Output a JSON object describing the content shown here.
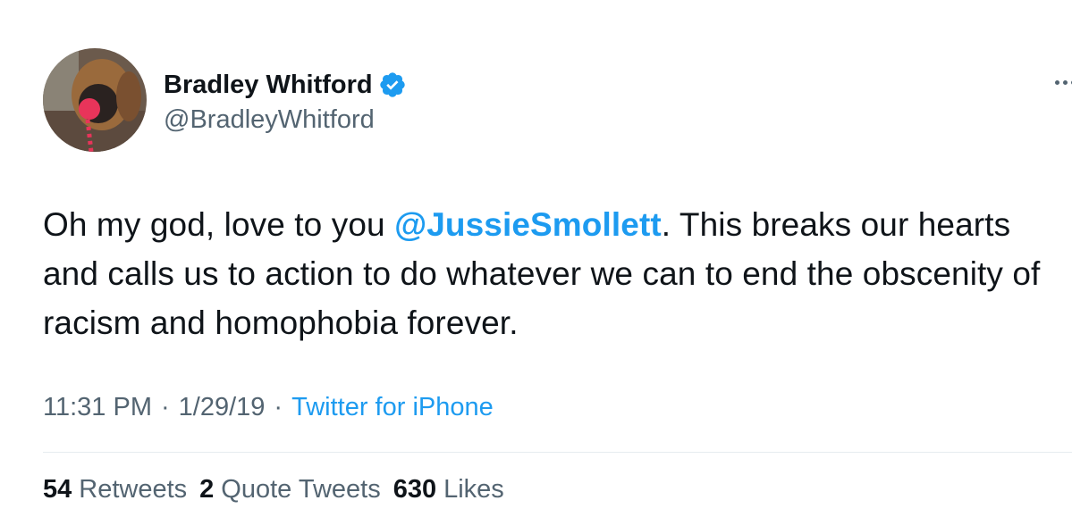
{
  "author": {
    "display_name": "Bradley Whitford",
    "handle": "@BradleyWhitford",
    "verified": true
  },
  "tweet": {
    "text_before_mention": "Oh my god, love to you ",
    "mention": "@JussieSmollett",
    "text_after_mention": ". This breaks our hearts and calls us to action to do whatever we can to end the obscenity of racism and homophobia forever."
  },
  "meta": {
    "time": "11:31 PM",
    "separator": "·",
    "date": "1/29/19",
    "source": "Twitter for iPhone"
  },
  "stats": {
    "retweets_count": "54",
    "retweets_label": "Retweets",
    "quotes_count": "2",
    "quotes_label": "Quote Tweets",
    "likes_count": "630",
    "likes_label": "Likes"
  },
  "colors": {
    "accent": "#1d9bf0",
    "text_primary": "#0f1419",
    "text_secondary": "#536471",
    "divider": "#e6ecf0"
  },
  "icons": {
    "verified": "verified-badge-icon",
    "more": "more-options-icon"
  }
}
